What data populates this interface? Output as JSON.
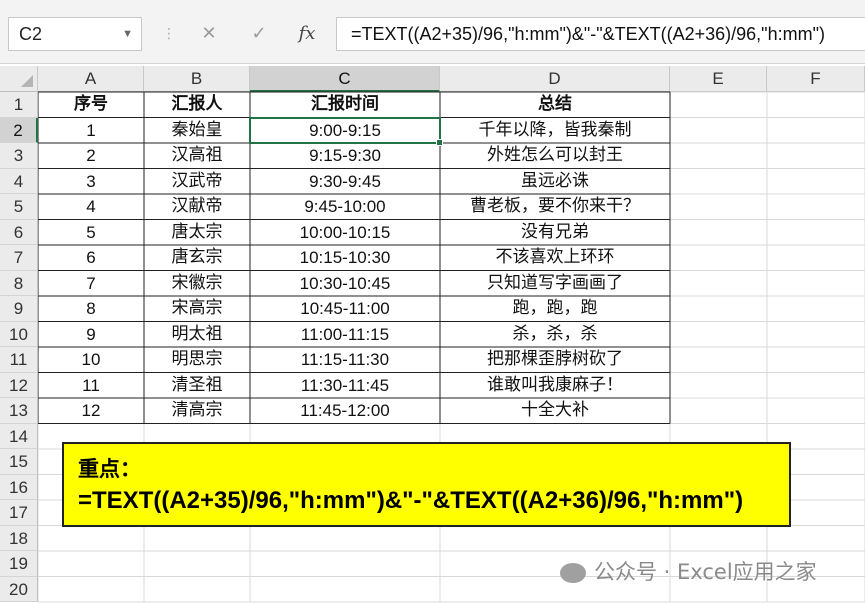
{
  "formula_bar": {
    "name_box": "C2",
    "cancel_icon": "✕",
    "enter_icon": "✓",
    "fx_label": "fx",
    "formula": "=TEXT((A2+35)/96,\"h:mm\")&\"-\"&TEXT((A2+36)/96,\"h:mm\")"
  },
  "columns": [
    "A",
    "B",
    "C",
    "D",
    "E",
    "F"
  ],
  "row_numbers": [
    "1",
    "2",
    "3",
    "4",
    "5",
    "6",
    "7",
    "8",
    "9",
    "10",
    "11",
    "12",
    "13",
    "14",
    "15",
    "16",
    "17",
    "18",
    "19",
    "20"
  ],
  "headers": [
    "序号",
    "汇报人",
    "汇报时间",
    "总结"
  ],
  "rows": [
    [
      "1",
      "秦始皇",
      "9:00-9:15",
      "千年以降，皆我秦制"
    ],
    [
      "2",
      "汉高祖",
      "9:15-9:30",
      "外姓怎么可以封王"
    ],
    [
      "3",
      "汉武帝",
      "9:30-9:45",
      "虽远必诛"
    ],
    [
      "4",
      "汉献帝",
      "9:45-10:00",
      "曹老板，要不你来干？"
    ],
    [
      "5",
      "唐太宗",
      "10:00-10:15",
      "没有兄弟"
    ],
    [
      "6",
      "唐玄宗",
      "10:15-10:30",
      "不该喜欢上环环"
    ],
    [
      "7",
      "宋徽宗",
      "10:30-10:45",
      "只知道写字画画了"
    ],
    [
      "8",
      "宋高宗",
      "10:45-11:00",
      "跑，跑，跑"
    ],
    [
      "9",
      "明太祖",
      "11:00-11:15",
      "杀，杀，杀"
    ],
    [
      "10",
      "明思宗",
      "11:15-11:30",
      "把那棵歪脖树砍了"
    ],
    [
      "11",
      "清圣祖",
      "11:30-11:45",
      "谁敢叫我康麻子！"
    ],
    [
      "12",
      "清高宗",
      "11:45-12:00",
      "十全大补"
    ]
  ],
  "callout": {
    "title": "重点：",
    "formula": "=TEXT((A2+35)/96,\"h:mm\")&\"-\"&TEXT((A2+36)/96,\"h:mm\")"
  },
  "watermark": "公众号 · Excel应用之家",
  "colors": {
    "selection": "#217346",
    "callout_bg": "#ffff00"
  }
}
